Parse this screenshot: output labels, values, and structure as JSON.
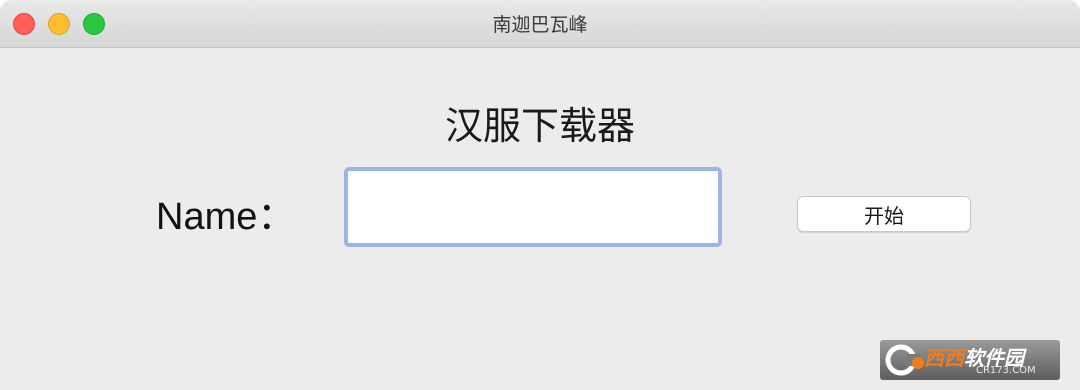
{
  "window": {
    "title": "南迦巴瓦峰"
  },
  "app": {
    "heading": "汉服下载器",
    "name_label": "Name：",
    "name_input_value": "",
    "start_button_label": "开始"
  },
  "watermark": {
    "brand_accent": "西西",
    "brand_rest": "软件园",
    "domain": "CR173.COM"
  },
  "colors": {
    "focus_ring": "#98b6e6",
    "traffic_close": "#fe5f57",
    "traffic_minimize": "#febc2e",
    "traffic_maximize": "#28c840",
    "window_bg": "#ececec"
  }
}
